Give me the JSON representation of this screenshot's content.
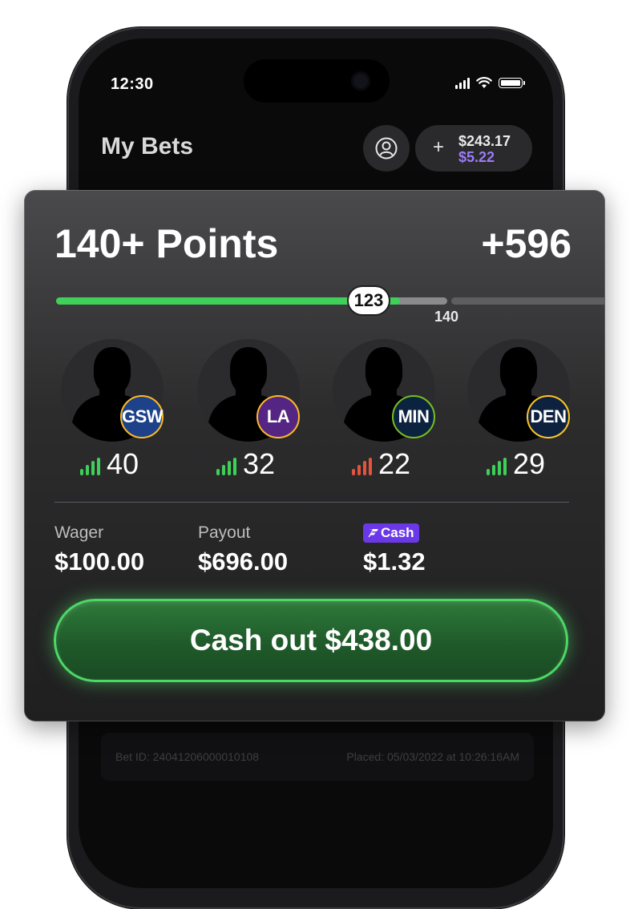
{
  "status": {
    "time": "12:30"
  },
  "header": {
    "title": "My Bets",
    "balance": "$243.17",
    "bonus": "$5.22",
    "add_symbol": "+"
  },
  "bet": {
    "title": "140+ Points",
    "odds": "+596",
    "current": "123",
    "target": "140",
    "progress_fraction": 0.879
  },
  "players": [
    {
      "team": "GSW",
      "value": "40",
      "trend": "up",
      "badge_bg": "#1d428a",
      "badge_ring": "#fdb927"
    },
    {
      "team": "LA",
      "value": "32",
      "trend": "up",
      "badge_bg": "#552583",
      "badge_ring": "#fdb927"
    },
    {
      "team": "MIN",
      "value": "22",
      "trend": "down",
      "badge_bg": "#0c2340",
      "badge_ring": "#78be20"
    },
    {
      "team": "DEN",
      "value": "29",
      "trend": "up",
      "badge_bg": "#0e2240",
      "badge_ring": "#fec524"
    }
  ],
  "summary": {
    "wager_label": "Wager",
    "wager_value": "$100.00",
    "payout_label": "Payout",
    "payout_value": "$696.00",
    "cash_label": "Cash",
    "cash_value": "$1.32"
  },
  "cashout": {
    "label": "Cash out $438.00"
  },
  "footer": {
    "bet_id": "Bet ID: 24041206000010108",
    "placed": "Placed: 05/03/2022 at 10:26:16AM"
  },
  "colors": {
    "accent_green": "#3fd05a",
    "trend_down": "#e5533d",
    "cash_purple": "#6b38e8",
    "bonus_purple": "#9b7cf5"
  },
  "icons": [
    "signal-icon",
    "wifi-icon",
    "battery-icon",
    "profile-icon",
    "plus-icon",
    "trend-bars-icon",
    "cash-logo-icon"
  ]
}
